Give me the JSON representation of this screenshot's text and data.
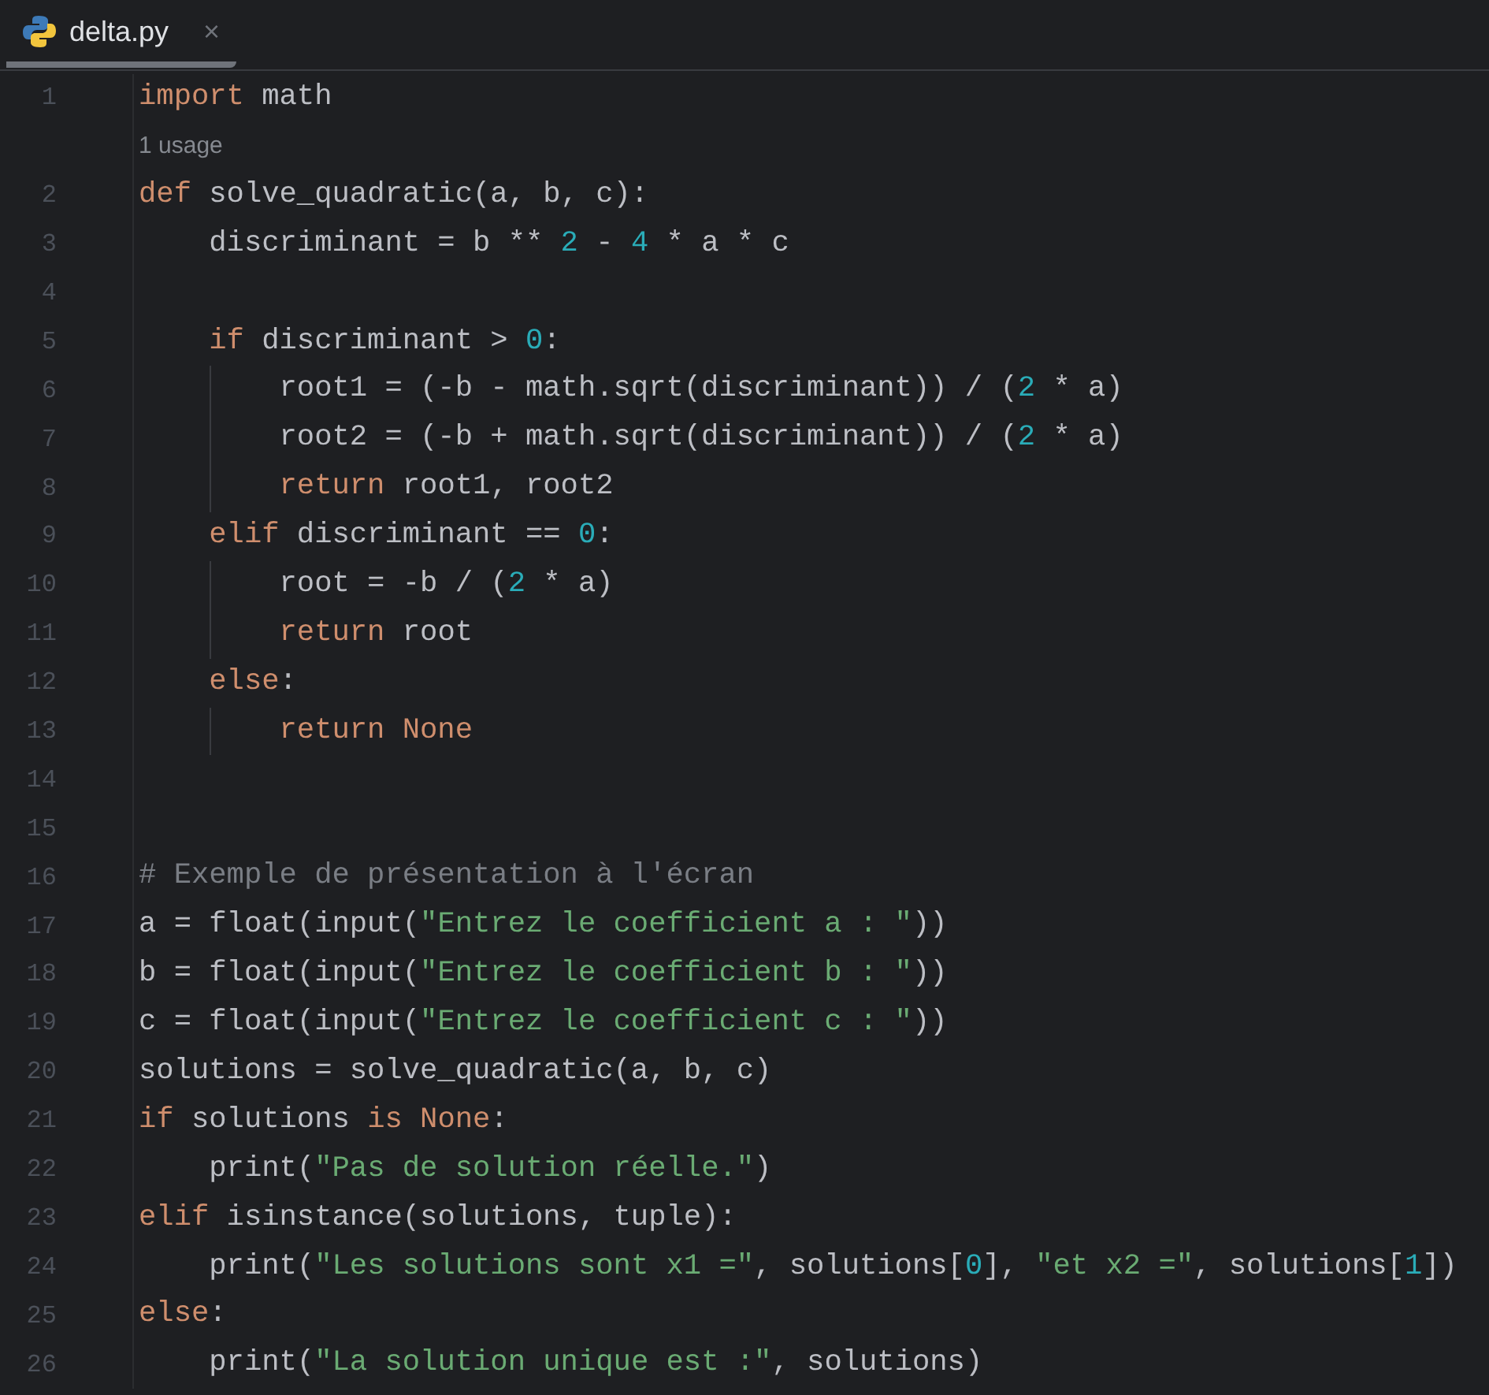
{
  "tab": {
    "title": "delta.py",
    "close": "×",
    "selected": true
  },
  "lines": [
    {
      "number": "1",
      "tokens": [
        {
          "kind": "keyword",
          "text": "import"
        },
        {
          "kind": "plain",
          "text": " math"
        }
      ]
    },
    {
      "kind": "hint",
      "text": "1 usage"
    },
    {
      "number": "2",
      "tokens": [
        {
          "kind": "keyword",
          "text": "def"
        },
        {
          "kind": "plain",
          "text": " solve_quadratic(a, b, c):"
        }
      ]
    },
    {
      "number": "3",
      "tokens": [
        {
          "kind": "plain",
          "text": "    discriminant = b ** "
        },
        {
          "kind": "number",
          "text": "2"
        },
        {
          "kind": "plain",
          "text": " - "
        },
        {
          "kind": "number",
          "text": "4"
        },
        {
          "kind": "plain",
          "text": " * a * c"
        }
      ]
    },
    {
      "number": "4"
    },
    {
      "number": "5",
      "tokens": [
        {
          "kind": "keyword",
          "text": "    if"
        },
        {
          "kind": "plain",
          "text": " discriminant > "
        },
        {
          "kind": "number",
          "text": "0"
        },
        {
          "kind": "plain",
          "text": ":"
        }
      ]
    },
    {
      "number": "6",
      "tokens": [
        {
          "kind": "plain",
          "text": "        root1 = (-b - math.sqrt(discriminant)) / ("
        },
        {
          "kind": "number",
          "text": "2"
        },
        {
          "kind": "plain",
          "text": " * a)"
        }
      ]
    },
    {
      "number": "7",
      "tokens": [
        {
          "kind": "plain",
          "text": "        root2 = (-b + math.sqrt(discriminant)) / ("
        },
        {
          "kind": "number",
          "text": "2"
        },
        {
          "kind": "plain",
          "text": " * a)"
        }
      ]
    },
    {
      "number": "8",
      "tokens": [
        {
          "kind": "keyword",
          "text": "        return"
        },
        {
          "kind": "plain",
          "text": " root1, root2"
        }
      ]
    },
    {
      "number": "9",
      "tokens": [
        {
          "kind": "keyword",
          "text": "    elif"
        },
        {
          "kind": "plain",
          "text": " discriminant == "
        },
        {
          "kind": "number",
          "text": "0"
        },
        {
          "kind": "plain",
          "text": ":"
        }
      ]
    },
    {
      "number": "10",
      "tokens": [
        {
          "kind": "plain",
          "text": "        root = -b / ("
        },
        {
          "kind": "number",
          "text": "2"
        },
        {
          "kind": "plain",
          "text": " * a)"
        }
      ]
    },
    {
      "number": "11",
      "tokens": [
        {
          "kind": "keyword",
          "text": "        return"
        },
        {
          "kind": "plain",
          "text": " root"
        }
      ]
    },
    {
      "number": "12",
      "tokens": [
        {
          "kind": "keyword",
          "text": "    else"
        },
        {
          "kind": "plain",
          "text": ":"
        }
      ]
    },
    {
      "number": "13",
      "tokens": [
        {
          "kind": "keyword",
          "text": "        return None"
        }
      ]
    },
    {
      "number": "14"
    },
    {
      "number": "15"
    },
    {
      "number": "16",
      "tokens": [
        {
          "kind": "comment",
          "text": "# Exemple de présentation à l'écran"
        }
      ]
    },
    {
      "number": "17",
      "tokens": [
        {
          "kind": "plain",
          "text": "a = float(input("
        },
        {
          "kind": "string",
          "text": "\"Entrez le coefficient a : \""
        },
        {
          "kind": "plain",
          "text": "))"
        }
      ]
    },
    {
      "number": "18",
      "tokens": [
        {
          "kind": "plain",
          "text": "b = float(input("
        },
        {
          "kind": "string",
          "text": "\"Entrez le coefficient b : \""
        },
        {
          "kind": "plain",
          "text": "))"
        }
      ]
    },
    {
      "number": "19",
      "tokens": [
        {
          "kind": "plain",
          "text": "c = float(input("
        },
        {
          "kind": "string",
          "text": "\"Entrez le coefficient c : \""
        },
        {
          "kind": "plain",
          "text": "))"
        }
      ]
    },
    {
      "number": "20",
      "tokens": [
        {
          "kind": "plain",
          "text": "solutions = solve_quadratic(a, b, c)"
        }
      ]
    },
    {
      "number": "21",
      "tokens": [
        {
          "kind": "keyword",
          "text": "if"
        },
        {
          "kind": "plain",
          "text": " solutions "
        },
        {
          "kind": "keyword",
          "text": "is None"
        },
        {
          "kind": "plain",
          "text": ":"
        }
      ]
    },
    {
      "number": "22",
      "tokens": [
        {
          "kind": "plain",
          "text": "    print("
        },
        {
          "kind": "string",
          "text": "\"Pas de solution réelle.\""
        },
        {
          "kind": "plain",
          "text": ")"
        }
      ]
    },
    {
      "number": "23",
      "tokens": [
        {
          "kind": "keyword",
          "text": "elif"
        },
        {
          "kind": "plain",
          "text": " isinstance(solutions, tuple):"
        }
      ]
    },
    {
      "number": "24",
      "tokens": [
        {
          "kind": "plain",
          "text": "    print("
        },
        {
          "kind": "string",
          "text": "\"Les solutions sont x1 =\""
        },
        {
          "kind": "plain",
          "text": ", solutions["
        },
        {
          "kind": "number",
          "text": "0"
        },
        {
          "kind": "plain",
          "text": "], "
        },
        {
          "kind": "string",
          "text": "\"et x2 =\""
        },
        {
          "kind": "plain",
          "text": ", solutions["
        },
        {
          "kind": "number",
          "text": "1"
        },
        {
          "kind": "plain",
          "text": "])"
        }
      ]
    },
    {
      "number": "25",
      "tokens": [
        {
          "kind": "keyword",
          "text": "else"
        },
        {
          "kind": "plain",
          "text": ":"
        }
      ]
    },
    {
      "number": "26",
      "tokens": [
        {
          "kind": "plain",
          "text": "    print("
        },
        {
          "kind": "string",
          "text": "\"La solution unique est :\""
        },
        {
          "kind": "plain",
          "text": ", solutions)"
        }
      ]
    }
  ]
}
